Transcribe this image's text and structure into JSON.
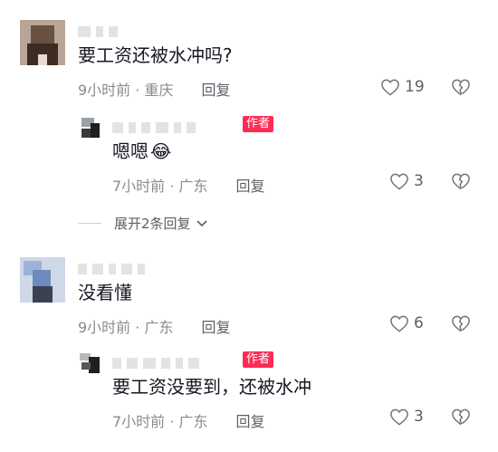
{
  "comments": [
    {
      "text": "要工资还被水冲吗?",
      "meta": "9小时前 · 重庆",
      "reply_label": "回复",
      "likes": "19",
      "replies": [
        {
          "badge": "作者",
          "text": "嗯嗯",
          "emoji": "😂",
          "meta": "7小时前 · 广东",
          "reply_label": "回复",
          "likes": "3"
        }
      ],
      "expand_label": "展开2条回复"
    },
    {
      "text": "没看懂",
      "meta": "9小时前 · 广东",
      "reply_label": "回复",
      "likes": "6",
      "replies": [
        {
          "badge": "作者",
          "text": "要工资没要到，还被水冲",
          "meta": "7小时前 · 广东",
          "reply_label": "回复",
          "likes": "3"
        }
      ]
    }
  ],
  "icons": {
    "like": "heart-outline-icon",
    "dislike": "broken-heart-icon",
    "expand": "chevron-down-icon"
  },
  "colors": {
    "author_badge": "#fe2c55",
    "meta_text": "#8a8b91",
    "main_text": "#161823"
  }
}
